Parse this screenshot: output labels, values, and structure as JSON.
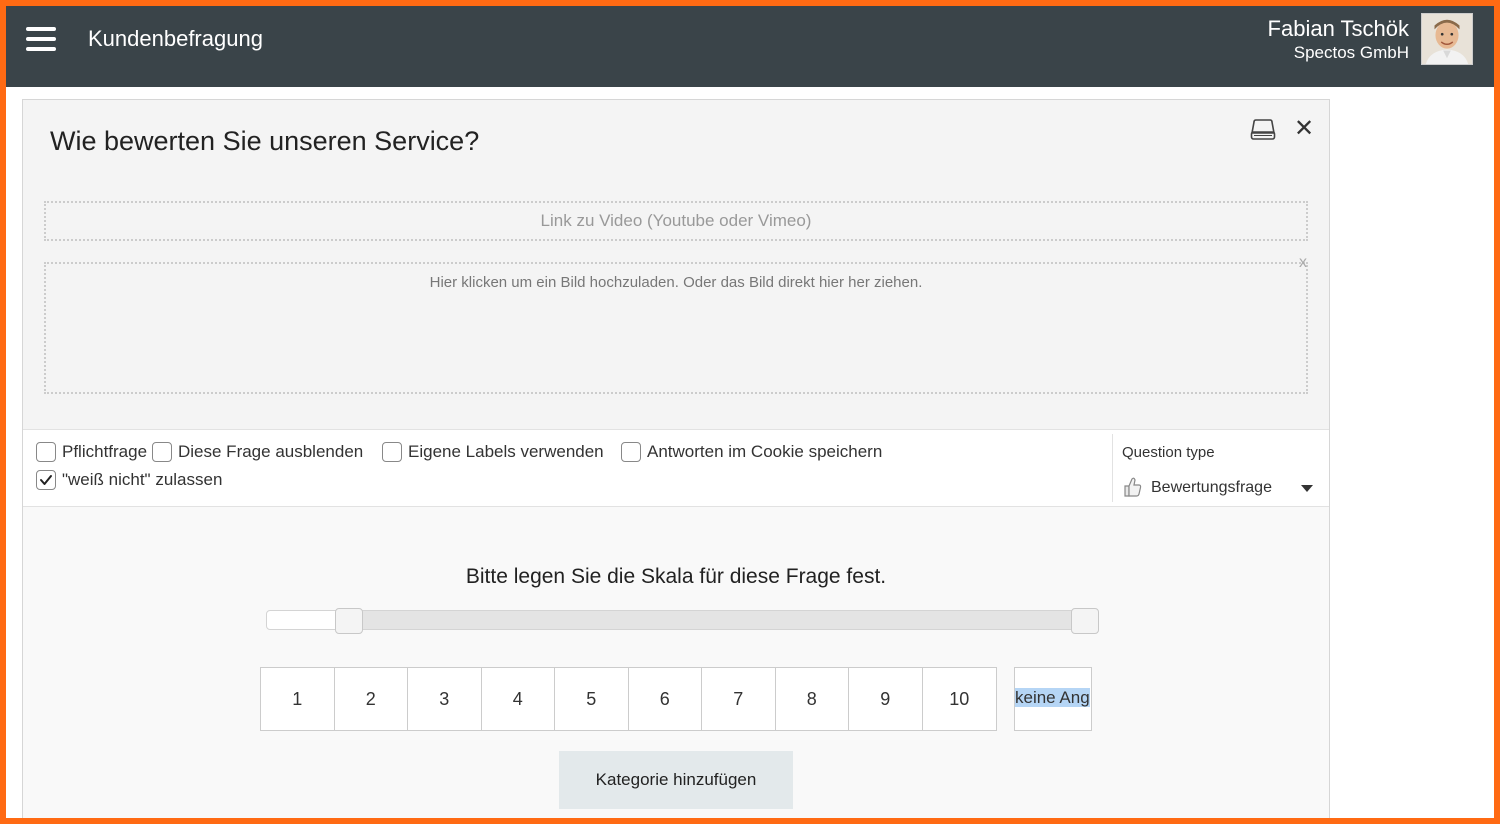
{
  "header": {
    "app_title": "Kundenbefragung",
    "user_name": "Fabian Tschök",
    "user_company": "Spectos GmbH"
  },
  "question": {
    "title": "Wie bewerten Sie unseren Service?",
    "video_placeholder": "Link zu Video (Youtube oder Vimeo)",
    "upload_text": "Hier klicken um ein Bild hochzuladen. Oder das Bild direkt hier her ziehen.",
    "upload_remove": "x",
    "close_symbol": "✕"
  },
  "options": [
    {
      "label": "Pflichtfrage",
      "checked": false
    },
    {
      "label": "Diese Frage ausblenden",
      "checked": false
    },
    {
      "label": "Eigene Labels verwenden",
      "checked": false
    },
    {
      "label": "Antworten im Cookie speichern",
      "checked": false
    },
    {
      "label": "\"weiß nicht\" zulassen",
      "checked": true
    }
  ],
  "question_type": {
    "label": "Question type",
    "value": "Bewertungsfrage",
    "icon": "thumbs-up-icon"
  },
  "scale": {
    "instruction": "Bitte legen Sie die Skala für diese Frage fest.",
    "values": [
      "1",
      "2",
      "3",
      "4",
      "5",
      "6",
      "7",
      "8",
      "9",
      "10"
    ],
    "no_answer_label": "keine Ang",
    "slider_min": 1,
    "slider_max": 10
  },
  "actions": {
    "add_category": "Kategorie hinzufügen"
  },
  "colors": {
    "frame_border": "#ff6a13",
    "topbar": "#3a4449",
    "button_bg": "#e3e9eb",
    "selection": "#b5d5f5"
  }
}
